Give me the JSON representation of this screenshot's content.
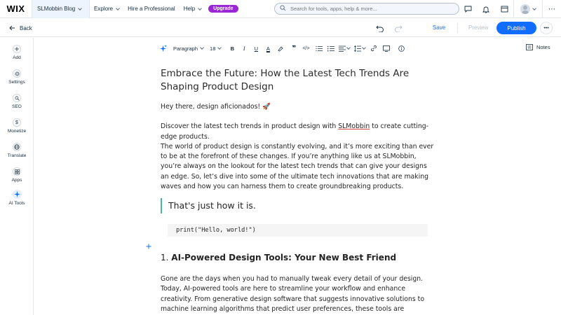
{
  "topbar": {
    "logo": "WIX",
    "site_name": "SLMobbin Blog",
    "nav": [
      {
        "label": "Explore"
      },
      {
        "label": "Hire a Professional"
      },
      {
        "label": "Help"
      }
    ],
    "upgrade_label": "Upgrade",
    "search_placeholder": "Search for tools, apps, help & more...",
    "icons": [
      "chat-icon",
      "bell-icon",
      "window-icon",
      "avatar",
      "more-icon"
    ]
  },
  "actionbar": {
    "back_label": "Back",
    "save_label": "Save",
    "preview_label": "Preview",
    "publish_label": "Publish"
  },
  "sidebar": {
    "items": [
      {
        "label": "Add",
        "icon": "plus-icon"
      },
      {
        "label": "Settings",
        "icon": "gear-icon"
      },
      {
        "label": "SEO",
        "icon": "search-icon"
      },
      {
        "label": "Monetize",
        "icon": "dollar-icon"
      },
      {
        "label": "Translate",
        "icon": "globe-icon"
      },
      {
        "label": "Apps",
        "icon": "apps-icon"
      },
      {
        "label": "AI Tools",
        "icon": "sparkle-icon"
      }
    ]
  },
  "toolbar": {
    "paragraph_style": "Paragraph",
    "font_size": "18",
    "notes_label": "Notes"
  },
  "article": {
    "title": "Embrace the Future: How the Latest Tech Trends Are Shaping Product Design",
    "greeting": "Hey there, design aficionados! 🚀",
    "intro_before": "Discover the latest tech trends in product design with ",
    "intro_brand": "SLMobbin",
    "intro_after": " to create cutting-edge products.",
    "body": "The world of product design is constantly evolving, and it’s more exciting than ever to be at the forefront of these changes. If you’re anything like us at SLMobbin, you’re always on the lookout for the latest tech trends that can give your designs an edge. So, let’s dive into some of the ultimate tech innovations that are making waves and how you can harness them to create groundbreaking products.",
    "quote": "That's just how it is.",
    "code": "print(\"Hello, world!\")",
    "h2_number": "1.",
    "h2_text": "AI-Powered Design Tools: Your New Best Friend",
    "para2": "Gone are the days when you had to manually tweak every detail of your design. Today, AI-powered tools are here to streamline your workflow and enhance creativity. From generative design software that suggests innovative solutions to machine learning algorithms that predict user preferences, these tools are changing the game."
  },
  "colors": {
    "accent": "#116dff",
    "upgrade": "#9a27d5",
    "quote_bar": "#45b7a0"
  }
}
